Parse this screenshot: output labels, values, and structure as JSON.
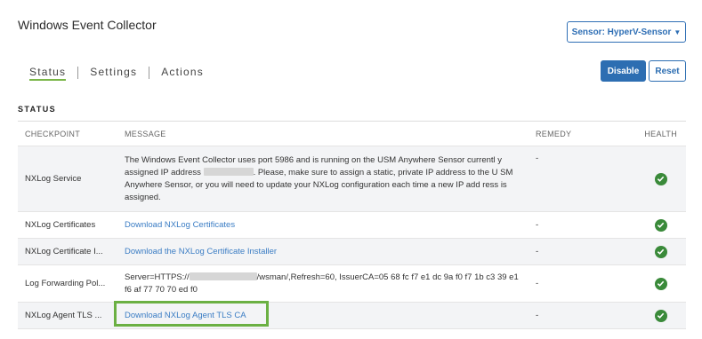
{
  "header": {
    "title": "Windows Event Collector",
    "sensor_button": "Sensor: HyperV-Sensor"
  },
  "tabs": [
    {
      "label": "Status",
      "active": true
    },
    {
      "label": "Settings",
      "active": false
    },
    {
      "label": "Actions",
      "active": false
    }
  ],
  "actions": {
    "disable": "Disable",
    "reset": "Reset"
  },
  "section_title": "STATUS",
  "table": {
    "columns": [
      "CHECKPOINT",
      "MESSAGE",
      "REMEDY",
      "HEALTH"
    ],
    "rows": [
      {
        "checkpoint": "NXLog Service",
        "message_part1": "The Windows Event Collector uses port 5986 and is running on the USM Anywhere Sensor currentl y assigned IP address",
        "message_part2": ". Please, make sure to assign a static, private IP address to the U SM Anywhere Sensor, or you will need to update your NXLog configuration each time a new IP add ress is assigned.",
        "remedy": "-",
        "health": "ok"
      },
      {
        "checkpoint": "NXLog Certificates",
        "message": "Download NXLog Certificates",
        "remedy": "-",
        "health": "ok"
      },
      {
        "checkpoint": "NXLog Certificate I...",
        "message": "Download the NXLog Certificate Installer",
        "remedy": "-",
        "health": "ok"
      },
      {
        "checkpoint": "Log Forwarding Pol...",
        "message_part1": "Server=HTTPS://",
        "message_part2": "/wsman/,Refresh=60, IssuerCA=05 68 fc f7 e1 dc 9a f0 f7 1b c3 39 e1 f6 af 77 70 70 ed f0",
        "remedy": "-",
        "health": "ok"
      },
      {
        "checkpoint": "NXLog Agent TLS ...",
        "message": "Download NXLog Agent TLS CA",
        "remedy": "-",
        "health": "ok"
      }
    ]
  },
  "colors": {
    "primary": "#2d6eb2",
    "link": "#3b7dc4",
    "health_ok": "#3a8a3a",
    "tab_underline": "#7ab648",
    "highlight": "#6bb043"
  },
  "icons": {
    "health_ok": "check-circle-icon",
    "dropdown": "chevron-down-icon"
  }
}
